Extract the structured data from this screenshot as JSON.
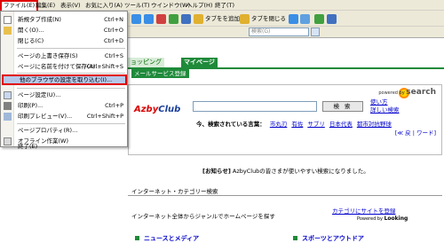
{
  "menubar": {
    "file": "ファイル(E)",
    "edit": "編集(E)",
    "view": "表示(V)",
    "favorites": "お気に入り(A)",
    "tools": "ツール(T)",
    "window": "ウインドウ(W)",
    "help": "ヘルプ(H)",
    "close": "終了(T)"
  },
  "toolbar": {
    "add_tab": "タブをを追加",
    "close_tab": "タブを閉じる"
  },
  "addressbar": {
    "search_placeholder": "検索(G)"
  },
  "file_menu": {
    "new_tab": "新規タブ作成(N)",
    "new_tab_sc": "Ctrl+N",
    "open": "開く(O)...",
    "open_sc": "Ctrl+O",
    "close": "閉じる(C)",
    "close_sc": "Ctrl+D",
    "save_overwrite": "ページの上書き保存(S)",
    "save_overwrite_sc": "Ctrl+S",
    "save_as": "ページに名前を付けて保存(A)...",
    "save_as_sc": "Ctrl+Shift+S",
    "import": "他のブラウザの設定を取り込む(I)...",
    "page_setup": "ページ設定(U)...",
    "print": "印刷(P)...",
    "print_sc": "Ctrl+P",
    "print_preview": "印刷プレビュー(V)...",
    "print_preview_sc": "Ctrl+Shift+P",
    "properties": "ページプロパティ(R)...",
    "offline": "オフライン作業(W)",
    "exit": "終了(E)"
  },
  "page": {
    "tab_shopping": "ョッピング",
    "tab_mypage": "マイページ",
    "subtab_mail": "メールサービス登録",
    "powered_by": "powered by",
    "powered_brand": "search",
    "logo_a": "Azby",
    "logo_b": "Club",
    "search_button": "検 索",
    "link_usage": "使い方",
    "link_detail": "詳しい検索",
    "kw_label": "今、検索されている言葉：",
    "keywords": [
      "市丸刃",
      "有佐",
      "サブリ",
      "日本代表",
      "都市対抗野球"
    ],
    "kw_back": "[≪ 戻 | ワード]",
    "notice_head": "[お知らせ]",
    "notice_body": "AzbyClubの皆さまが使いやすい検索になりました。",
    "section_title": "インターネット・カテゴリー検索",
    "cat_desc": "インターネット全体からジャンルでホームページを探す",
    "cat_link": "カテゴリにサイトを登録",
    "cat_powered": "Powered by",
    "cat_powered_brand": "Looking",
    "cat1": "ニュースとメディア",
    "cat2": "スポーツとアウトドア"
  },
  "colors": {
    "accent_green": "#1f8a3a",
    "highlight_red": "#e00000",
    "menu_highlight": "#b6c8ea"
  }
}
